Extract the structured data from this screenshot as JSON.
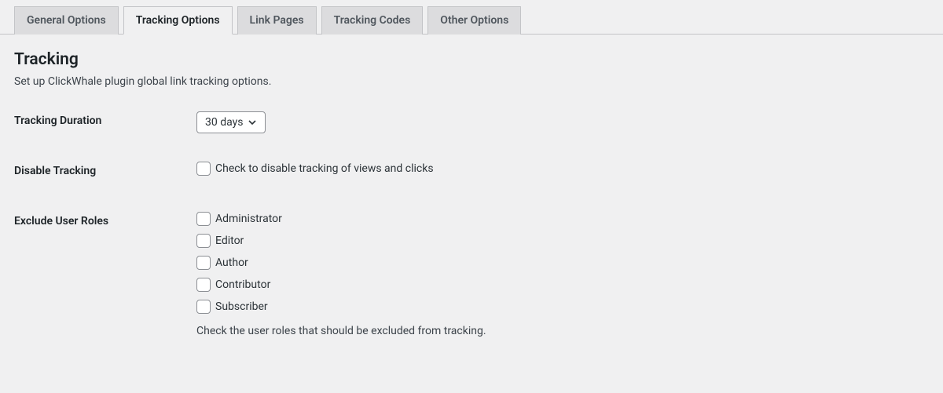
{
  "tabs": [
    {
      "label": "General Options",
      "active": false
    },
    {
      "label": "Tracking Options",
      "active": true
    },
    {
      "label": "Link Pages",
      "active": false
    },
    {
      "label": "Tracking Codes",
      "active": false
    },
    {
      "label": "Other Options",
      "active": false
    }
  ],
  "section": {
    "title": "Tracking",
    "description": "Set up ClickWhale plugin global link tracking options."
  },
  "fields": {
    "tracking_duration": {
      "label": "Tracking Duration",
      "value": "30 days"
    },
    "disable_tracking": {
      "label": "Disable Tracking",
      "checkbox_label": "Check to disable tracking of views and clicks",
      "checked": false
    },
    "exclude_user_roles": {
      "label": "Exclude User Roles",
      "roles": [
        {
          "label": "Administrator",
          "checked": false
        },
        {
          "label": "Editor",
          "checked": false
        },
        {
          "label": "Author",
          "checked": false
        },
        {
          "label": "Contributor",
          "checked": false
        },
        {
          "label": "Subscriber",
          "checked": false
        }
      ],
      "help": "Check the user roles that should be excluded from tracking."
    }
  }
}
